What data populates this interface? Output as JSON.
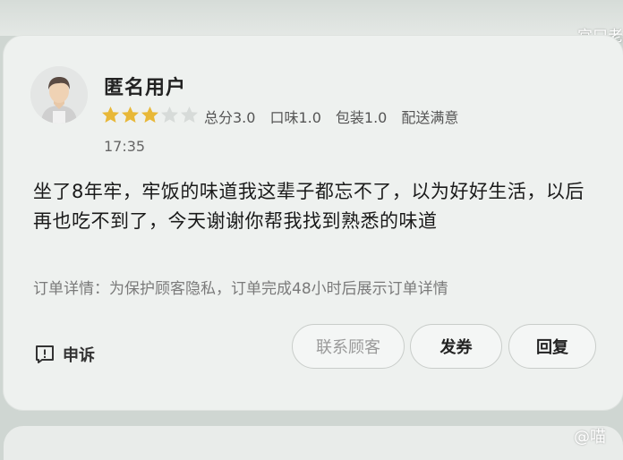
{
  "watermark": {
    "top": "宫口老",
    "bottom": "@喵"
  },
  "review": {
    "username": "匿名用户",
    "rating": 3,
    "rating_max": 5,
    "star_color_on": "#e8b838",
    "star_color_off": "#d7dbd9",
    "scores": {
      "total": "总分3.0",
      "taste": "口味1.0",
      "package": "包装1.0",
      "delivery": "配送满意"
    },
    "time": "17:35",
    "text": "坐了8年牢，牢饭的味道我这辈子都忘不了，以为好好生活，以后再也吃不到了，今天谢谢你帮我找到熟悉的味道",
    "order_detail": "订单详情：为保护顾客隐私，订单完成48小时后展示订单详情"
  },
  "actions": {
    "appeal_label": "申诉",
    "contact_label": "联系顾客",
    "coupon_label": "发券",
    "reply_label": "回复"
  },
  "icons": {
    "avatar": "default-user-avatar-icon",
    "appeal": "exclamation-square-icon",
    "star": "star-icon"
  }
}
